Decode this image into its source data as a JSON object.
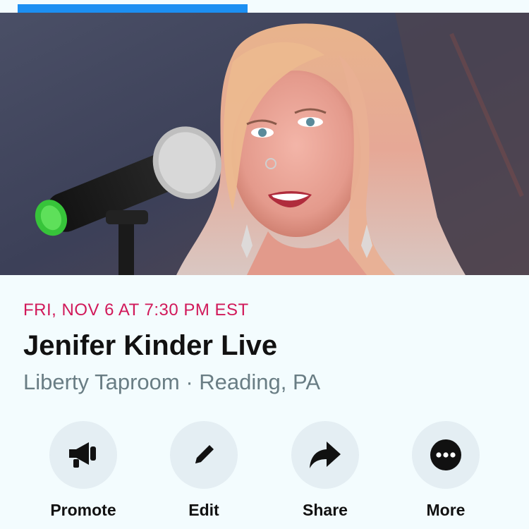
{
  "progress": {
    "fraction": 0.435,
    "color": "#1c8ff2"
  },
  "event": {
    "date": "FRI, NOV 6 AT 7:30 PM EST",
    "title": "Jenifer Kinder Live",
    "location": "Liberty Taproom · Reading, PA"
  },
  "actions": [
    {
      "label": "Promote",
      "icon": "megaphone-icon"
    },
    {
      "label": "Edit",
      "icon": "pencil-icon"
    },
    {
      "label": "Share",
      "icon": "share-arrow-icon"
    },
    {
      "label": "More",
      "icon": "more-dots-icon"
    }
  ],
  "colors": {
    "date": "#d1195a",
    "background": "#f3fcfe",
    "icon_circle": "#e4eef3"
  }
}
